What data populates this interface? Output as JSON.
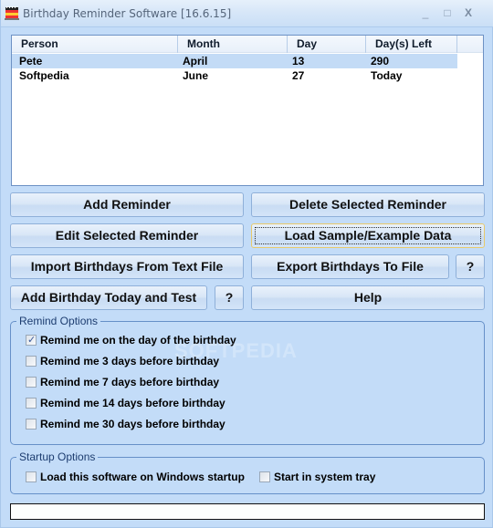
{
  "window": {
    "title": "Birthday Reminder Software [16.6.15]",
    "icon": "birthday-cake-icon",
    "controls": {
      "minimize": "_",
      "maximize": "□",
      "close": "X"
    }
  },
  "list": {
    "columns": [
      "Person",
      "Month",
      "Day",
      "Day(s) Left"
    ],
    "rows": [
      {
        "person": "Pete",
        "month": "April",
        "day": "13",
        "days_left": "290",
        "selected": true
      },
      {
        "person": "Softpedia",
        "month": "June",
        "day": "27",
        "days_left": "Today",
        "selected": false
      }
    ]
  },
  "buttons": {
    "add_reminder": "Add Reminder",
    "delete_selected": "Delete Selected Reminder",
    "edit_selected": "Edit Selected Reminder",
    "load_sample": "Load Sample/Example Data",
    "import_text": "Import Birthdays From Text File",
    "export_file": "Export Birthdays To File",
    "export_help": "?",
    "add_today_test": "Add Birthday Today and Test",
    "add_today_help": "?",
    "help": "Help"
  },
  "remind_options": {
    "title": "Remind Options",
    "items": [
      {
        "label": "Remind me on the day of the birthday",
        "checked": true
      },
      {
        "label": "Remind me 3 days before birthday",
        "checked": false
      },
      {
        "label": "Remind me 7 days before birthday",
        "checked": false
      },
      {
        "label": "Remind me 14 days before birthday",
        "checked": false
      },
      {
        "label": "Remind me 30 days before birthday",
        "checked": false
      }
    ]
  },
  "startup_options": {
    "title": "Startup Options",
    "items": [
      {
        "label": "Load this software on Windows startup",
        "checked": false
      },
      {
        "label": "Start in system tray",
        "checked": false
      }
    ]
  },
  "status": {
    "text": ""
  },
  "watermark": "SOFTPEDIA",
  "check_glyph": "✓"
}
